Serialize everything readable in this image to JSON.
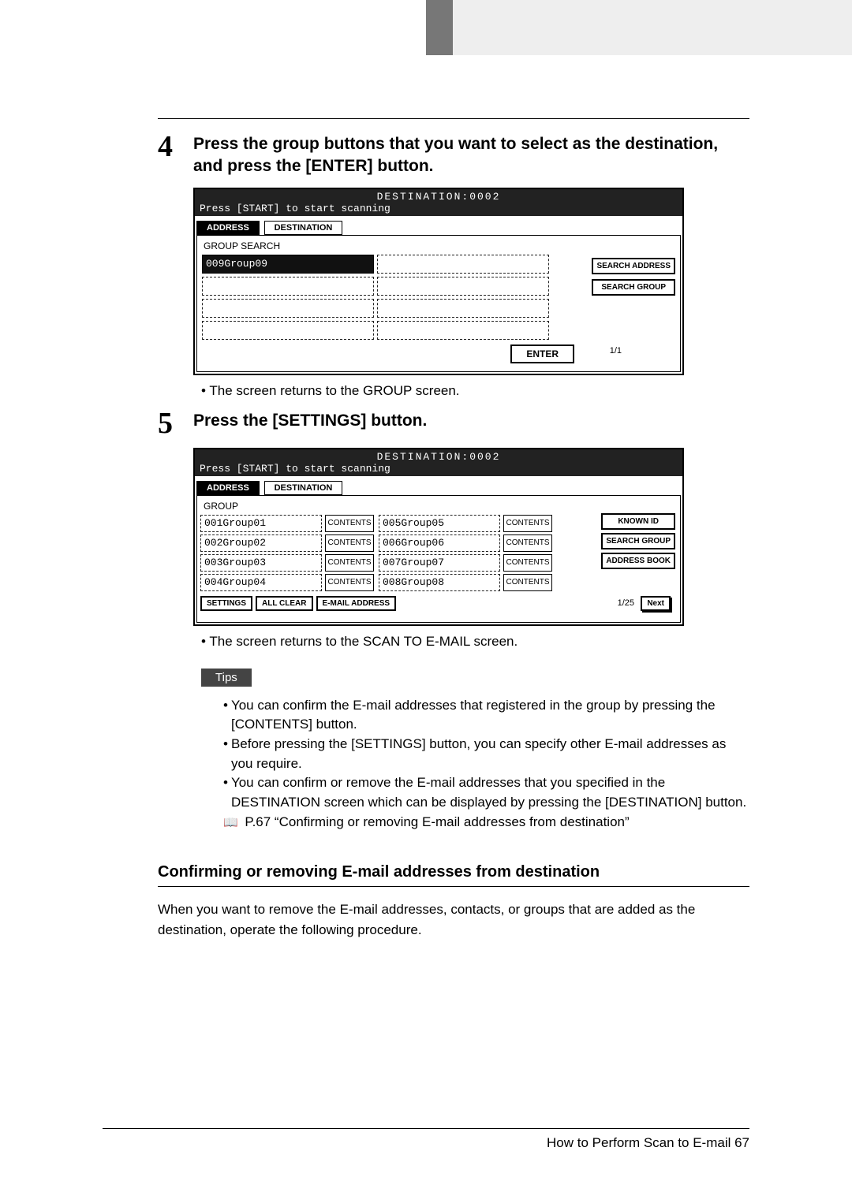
{
  "header": {},
  "step4": {
    "num": "4",
    "title": "Press the group buttons that you want to select as the destination, and press the [ENTER] button.",
    "screen": {
      "dest_header": "DESTINATION:0002",
      "start_prompt": "Press [START] to start scanning",
      "tab_address": "ADDRESS",
      "tab_destination": "DESTINATION",
      "subtitle": "GROUP SEARCH",
      "selected_slot": "009Group09",
      "btn_search_address": "SEARCH ADDRESS",
      "btn_search_group": "SEARCH GROUP",
      "enter": "ENTER",
      "page": "1/1"
    },
    "return_note": "The screen returns to the GROUP screen."
  },
  "step5": {
    "num": "5",
    "title": "Press the [SETTINGS] button.",
    "screen": {
      "dest_header": "DESTINATION:0002",
      "start_prompt": "Press [START] to start scanning",
      "tab_address": "ADDRESS",
      "tab_destination": "DESTINATION",
      "subtitle": "GROUP",
      "rows_left": [
        {
          "id": "001",
          "name": "Group01"
        },
        {
          "id": "002",
          "name": "Group02"
        },
        {
          "id": "003",
          "name": "Group03"
        },
        {
          "id": "004",
          "name": "Group04"
        }
      ],
      "rows_right": [
        {
          "id": "005",
          "name": "Group05"
        },
        {
          "id": "006",
          "name": "Group06"
        },
        {
          "id": "007",
          "name": "Group07"
        },
        {
          "id": "008",
          "name": "Group08"
        }
      ],
      "contents_label": "CONTENTS",
      "btn_known_id": "KNOWN ID",
      "btn_search_group": "SEARCH GROUP",
      "btn_address_book": "ADDRESS BOOK",
      "footer_settings": "SETTINGS",
      "footer_all_clear": "ALL CLEAR",
      "footer_email_addr": "E-MAIL ADDRESS",
      "page": "1/25",
      "next": "Next"
    },
    "return_note": "The screen returns to the SCAN TO E-MAIL screen."
  },
  "tips": {
    "label": "Tips",
    "items": [
      "You can confirm the E-mail addresses that registered in the group by pressing the [CONTENTS] button.",
      "Before pressing the [SETTINGS] button, you can specify other E-mail addresses as you require.",
      "You can confirm or remove the E-mail addresses that you specified in the DESTINATION screen which can be displayed by pressing the [DESTINATION] button."
    ],
    "xref_icon": "📖",
    "xref": "P.67 “Confirming or removing E-mail addresses from destination”"
  },
  "section": {
    "heading": "Confirming or removing E-mail addresses from destination",
    "para": "When you want to remove the E-mail addresses, contacts, or groups that are added as the destination, operate the following procedure."
  },
  "footer": {
    "text": "How to Perform Scan to E-mail    67"
  }
}
